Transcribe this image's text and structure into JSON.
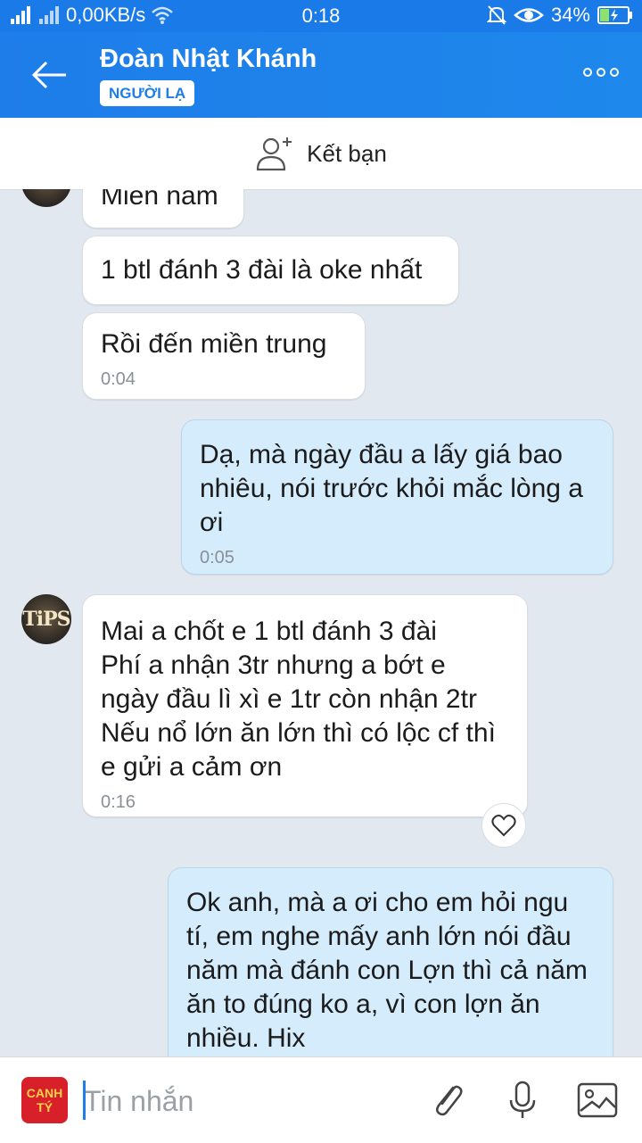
{
  "status": {
    "speed": "0,00KB/s",
    "time": "0:18",
    "battery": "34%",
    "icons": [
      "signal-icon",
      "wifi-icon",
      "mute-icon",
      "eye-icon",
      "battery-icon"
    ]
  },
  "header": {
    "title": "Đoàn Nhật Khánh",
    "badge": "NGƯỜI LẠ"
  },
  "add_friend": {
    "label": "Kết bạn"
  },
  "messages": [
    {
      "side": "in",
      "text": "Miền nam",
      "time": ""
    },
    {
      "side": "in",
      "text": "1 btl đánh 3 đài là oke nhất",
      "time": ""
    },
    {
      "side": "in",
      "text": "Rồi đến miền trung",
      "time": "0:04"
    },
    {
      "side": "out",
      "text": "Dạ, mà ngày đầu a lấy giá bao nhiêu,  nói trước khỏi mắc lòng a ơi",
      "time": "0:05"
    },
    {
      "side": "in",
      "lines": [
        "Mai a chốt e 1 btl đánh 3 đài",
        "Phí a nhận 3tr nhưng a bớt e ngày đầu lì xì e 1tr còn nhận 2tr",
        "Nếu nổ lớn ăn lớn thì có lộc cf thì e gửi a cảm ơn"
      ],
      "time": "0:16"
    },
    {
      "side": "out",
      "text": "Ok anh,  mà a ơi cho em hỏi ngu tí,  em nghe mấy anh lớn nói đầu năm mà đánh con Lợn thì cả năm ăn to đúng ko a,  vì con lợn ăn nhiều. Hix",
      "time": ""
    }
  ],
  "avatar_text": "TiPS",
  "composer": {
    "placeholder": "Tin nhắn",
    "sticker_line1": "CANH",
    "sticker_line2": "TÝ"
  },
  "colors": {
    "brand": "#1e7de9",
    "outgoing": "#d4ecfc",
    "background": "#e2e8ef"
  }
}
